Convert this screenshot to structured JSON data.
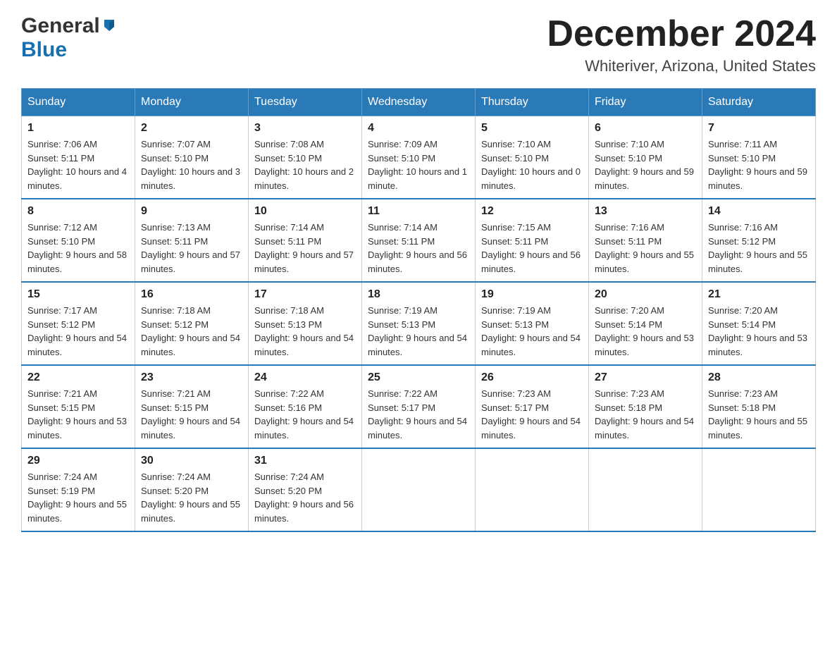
{
  "header": {
    "logo_general": "General",
    "logo_blue": "Blue",
    "month_title": "December 2024",
    "location": "Whiteriver, Arizona, United States"
  },
  "days_of_week": [
    "Sunday",
    "Monday",
    "Tuesday",
    "Wednesday",
    "Thursday",
    "Friday",
    "Saturday"
  ],
  "weeks": [
    [
      {
        "day": "1",
        "sunrise": "7:06 AM",
        "sunset": "5:11 PM",
        "daylight": "10 hours and 4 minutes."
      },
      {
        "day": "2",
        "sunrise": "7:07 AM",
        "sunset": "5:10 PM",
        "daylight": "10 hours and 3 minutes."
      },
      {
        "day": "3",
        "sunrise": "7:08 AM",
        "sunset": "5:10 PM",
        "daylight": "10 hours and 2 minutes."
      },
      {
        "day": "4",
        "sunrise": "7:09 AM",
        "sunset": "5:10 PM",
        "daylight": "10 hours and 1 minute."
      },
      {
        "day": "5",
        "sunrise": "7:10 AM",
        "sunset": "5:10 PM",
        "daylight": "10 hours and 0 minutes."
      },
      {
        "day": "6",
        "sunrise": "7:10 AM",
        "sunset": "5:10 PM",
        "daylight": "9 hours and 59 minutes."
      },
      {
        "day": "7",
        "sunrise": "7:11 AM",
        "sunset": "5:10 PM",
        "daylight": "9 hours and 59 minutes."
      }
    ],
    [
      {
        "day": "8",
        "sunrise": "7:12 AM",
        "sunset": "5:10 PM",
        "daylight": "9 hours and 58 minutes."
      },
      {
        "day": "9",
        "sunrise": "7:13 AM",
        "sunset": "5:11 PM",
        "daylight": "9 hours and 57 minutes."
      },
      {
        "day": "10",
        "sunrise": "7:14 AM",
        "sunset": "5:11 PM",
        "daylight": "9 hours and 57 minutes."
      },
      {
        "day": "11",
        "sunrise": "7:14 AM",
        "sunset": "5:11 PM",
        "daylight": "9 hours and 56 minutes."
      },
      {
        "day": "12",
        "sunrise": "7:15 AM",
        "sunset": "5:11 PM",
        "daylight": "9 hours and 56 minutes."
      },
      {
        "day": "13",
        "sunrise": "7:16 AM",
        "sunset": "5:11 PM",
        "daylight": "9 hours and 55 minutes."
      },
      {
        "day": "14",
        "sunrise": "7:16 AM",
        "sunset": "5:12 PM",
        "daylight": "9 hours and 55 minutes."
      }
    ],
    [
      {
        "day": "15",
        "sunrise": "7:17 AM",
        "sunset": "5:12 PM",
        "daylight": "9 hours and 54 minutes."
      },
      {
        "day": "16",
        "sunrise": "7:18 AM",
        "sunset": "5:12 PM",
        "daylight": "9 hours and 54 minutes."
      },
      {
        "day": "17",
        "sunrise": "7:18 AM",
        "sunset": "5:13 PM",
        "daylight": "9 hours and 54 minutes."
      },
      {
        "day": "18",
        "sunrise": "7:19 AM",
        "sunset": "5:13 PM",
        "daylight": "9 hours and 54 minutes."
      },
      {
        "day": "19",
        "sunrise": "7:19 AM",
        "sunset": "5:13 PM",
        "daylight": "9 hours and 54 minutes."
      },
      {
        "day": "20",
        "sunrise": "7:20 AM",
        "sunset": "5:14 PM",
        "daylight": "9 hours and 53 minutes."
      },
      {
        "day": "21",
        "sunrise": "7:20 AM",
        "sunset": "5:14 PM",
        "daylight": "9 hours and 53 minutes."
      }
    ],
    [
      {
        "day": "22",
        "sunrise": "7:21 AM",
        "sunset": "5:15 PM",
        "daylight": "9 hours and 53 minutes."
      },
      {
        "day": "23",
        "sunrise": "7:21 AM",
        "sunset": "5:15 PM",
        "daylight": "9 hours and 54 minutes."
      },
      {
        "day": "24",
        "sunrise": "7:22 AM",
        "sunset": "5:16 PM",
        "daylight": "9 hours and 54 minutes."
      },
      {
        "day": "25",
        "sunrise": "7:22 AM",
        "sunset": "5:17 PM",
        "daylight": "9 hours and 54 minutes."
      },
      {
        "day": "26",
        "sunrise": "7:23 AM",
        "sunset": "5:17 PM",
        "daylight": "9 hours and 54 minutes."
      },
      {
        "day": "27",
        "sunrise": "7:23 AM",
        "sunset": "5:18 PM",
        "daylight": "9 hours and 54 minutes."
      },
      {
        "day": "28",
        "sunrise": "7:23 AM",
        "sunset": "5:18 PM",
        "daylight": "9 hours and 55 minutes."
      }
    ],
    [
      {
        "day": "29",
        "sunrise": "7:24 AM",
        "sunset": "5:19 PM",
        "daylight": "9 hours and 55 minutes."
      },
      {
        "day": "30",
        "sunrise": "7:24 AM",
        "sunset": "5:20 PM",
        "daylight": "9 hours and 55 minutes."
      },
      {
        "day": "31",
        "sunrise": "7:24 AM",
        "sunset": "5:20 PM",
        "daylight": "9 hours and 56 minutes."
      },
      null,
      null,
      null,
      null
    ]
  ]
}
